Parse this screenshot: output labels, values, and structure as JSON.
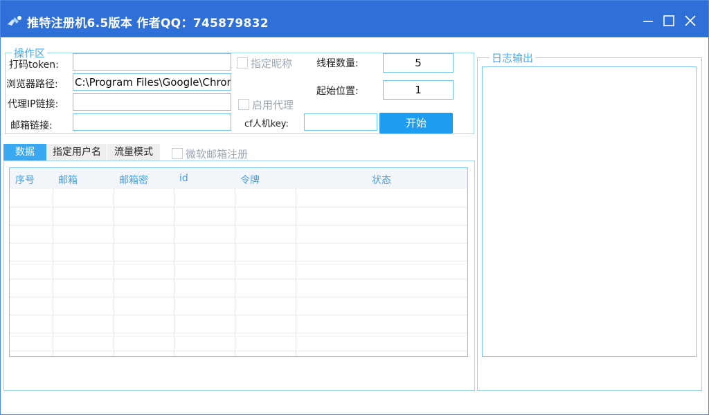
{
  "window": {
    "title": "推特注册机6.5版本 作者QQ：745879832"
  },
  "operation_group": {
    "legend": "操作区",
    "token_label": "打码token:",
    "token_value": "",
    "browser_path_label": "浏览器路径:",
    "browser_path_value": "C:\\Program Files\\Google\\Chrome",
    "proxy_label": "代理IP链接:",
    "proxy_value": "",
    "mailbox_label": "邮箱链接:",
    "mailbox_value": "",
    "nickname_checkbox": "指定昵称",
    "proxy_checkbox": "启用代理",
    "thread_label": "线程数量:",
    "thread_value": "5",
    "start_pos_label": "起始位置:",
    "start_pos_value": "1",
    "cf_key_label": "cf人机key:",
    "cf_key_value": "",
    "start_button": "开始"
  },
  "tabs": [
    {
      "label": "数据",
      "active": true
    },
    {
      "label": "指定用户名",
      "active": false
    },
    {
      "label": "流量模式",
      "active": false
    }
  ],
  "ms_mail_checkbox": "微软邮箱注册",
  "table": {
    "columns": [
      "序号",
      "邮箱",
      "邮箱密",
      "id",
      "令牌",
      "状态"
    ]
  },
  "log_group": {
    "legend": "日志输出"
  },
  "colors": {
    "titlebar": "#2f6fd8",
    "accent": "#1e9cf0",
    "border": "#9ed6f2"
  }
}
